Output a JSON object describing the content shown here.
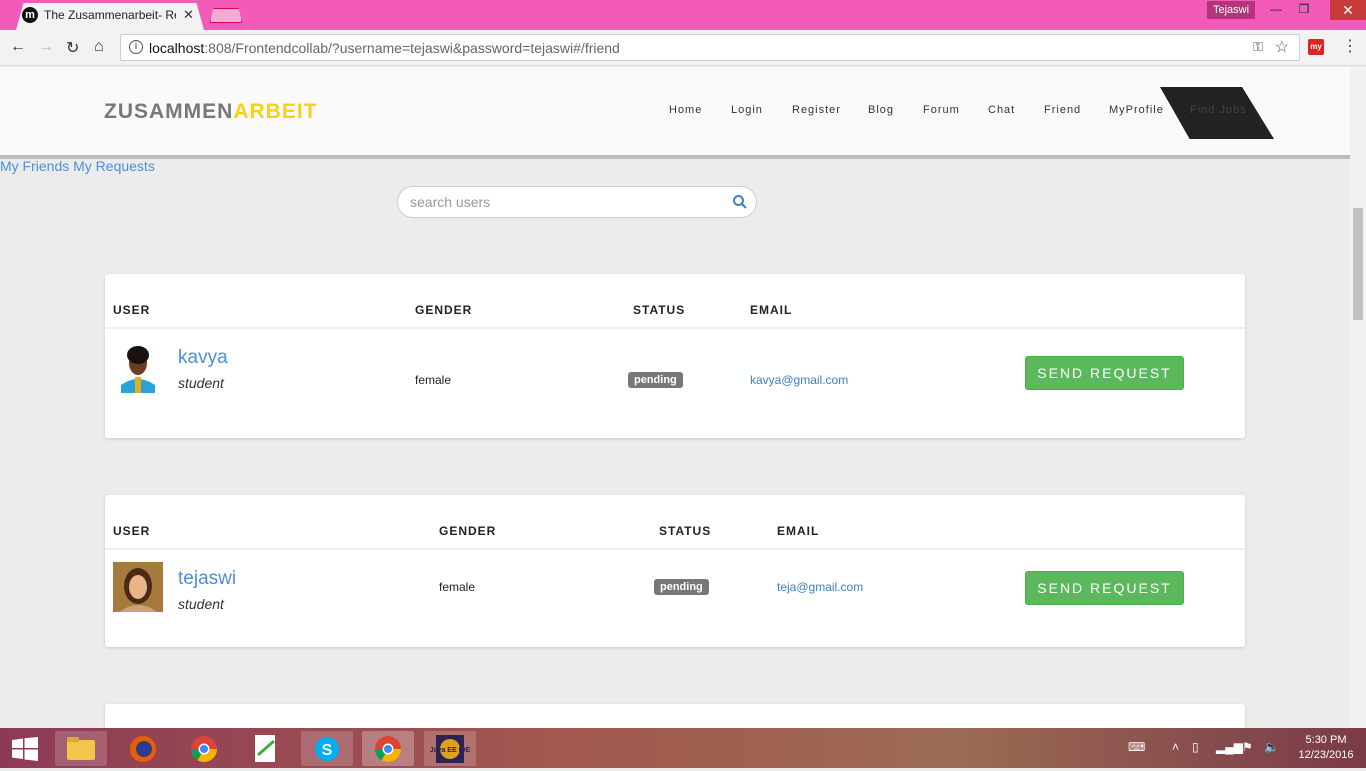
{
  "browser": {
    "tab_title": "The Zusammenarbeit- Re",
    "tab_icon_letter": "m",
    "profile_name": "Tejaswi",
    "url_host": "localhost",
    "url_rest": ":808/Frontendcollab/?username=tejaswi&password=tejaswi#/friend",
    "extension_label": "my"
  },
  "site": {
    "brand_part1": "ZUSAMMEN",
    "brand_part2": "ARBEIT",
    "nav": [
      "Home",
      "Login",
      "Register",
      "Blog",
      "Forum",
      "Chat",
      "Friend",
      "MyProfile",
      "Find Jobs"
    ],
    "links": "My Friends My Requests"
  },
  "search": {
    "placeholder": "search users"
  },
  "columns": {
    "user": "USER",
    "gender": "GENDER",
    "status": "STATUS",
    "email": "EMAIL"
  },
  "users": [
    {
      "name": "kavya",
      "role": "student",
      "gender": "female",
      "status": "pending",
      "email": "kavya@gmail.com",
      "button": "SEND REQUEST"
    },
    {
      "name": "tejaswi",
      "role": "student",
      "gender": "female",
      "status": "pending",
      "email": "teja@gmail.com",
      "button": "SEND REQUEST"
    }
  ],
  "taskbar": {
    "time": "5:30 PM",
    "date": "12/23/2016",
    "eclipse_label": "Java EE IDE"
  }
}
